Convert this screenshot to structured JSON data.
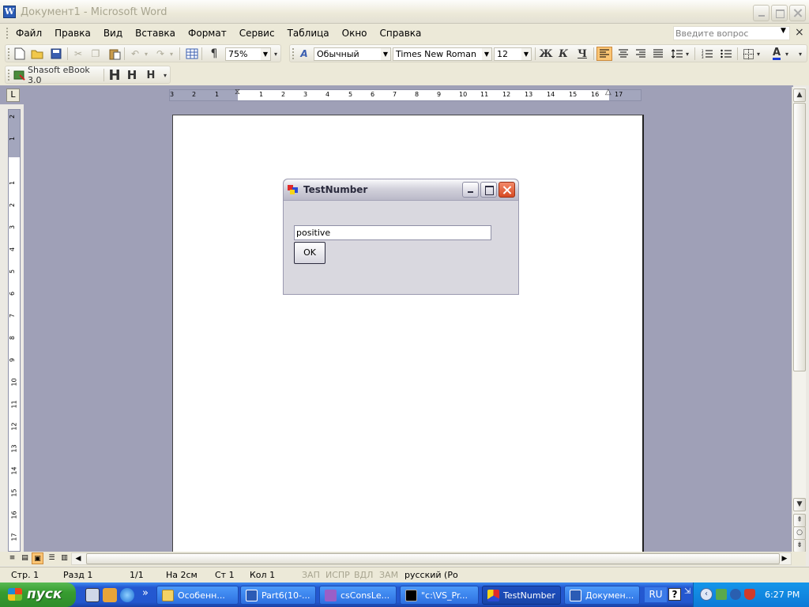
{
  "window": {
    "title": "Документ1 - Microsoft Word",
    "icon": "word-doc-icon"
  },
  "menubar": {
    "items": [
      "Файл",
      "Правка",
      "Вид",
      "Вставка",
      "Формат",
      "Сервис",
      "Таблица",
      "Окно",
      "Справка"
    ],
    "ask_placeholder": "Введите вопрос"
  },
  "standard_toolbar": {
    "zoom": "75%",
    "paragraph_mark": "¶"
  },
  "format_toolbar": {
    "style": "Обычный",
    "font": "Times New Roman",
    "size": "12",
    "bold": "Ж",
    "italic": "К",
    "underline": "Ч"
  },
  "ebook_toolbar": {
    "label": "Shasoft eBook 3.0",
    "h1": "H",
    "h2": "H",
    "h3": "H"
  },
  "ruler": {
    "tab_selector": "L",
    "h_ticks": [
      "3",
      "2",
      "1",
      "1",
      "2",
      "3",
      "4",
      "5",
      "6",
      "7",
      "8",
      "9",
      "10",
      "11",
      "12",
      "13",
      "14",
      "15",
      "16",
      "17"
    ],
    "v_ticks": [
      "2",
      "1",
      "1",
      "2",
      "3",
      "4",
      "5",
      "6",
      "7",
      "8",
      "9",
      "10",
      "11",
      "12",
      "13",
      "14",
      "15",
      "16",
      "17"
    ]
  },
  "dialog": {
    "title": "TestNumber",
    "input_value": "positive",
    "ok_label": "OK"
  },
  "statusbar": {
    "page": "Стр. 1",
    "section": "Разд 1",
    "pages": "1/1",
    "at": "На 2см",
    "line": "Ст 1",
    "col": "Кол 1",
    "rec": "ЗАП",
    "trk": "ИСПР",
    "ext": "ВДЛ",
    "ovr": "ЗАМ",
    "language": "русский (Ро"
  },
  "taskbar": {
    "start_label": "пуск",
    "tasks": [
      {
        "label": "Особенн...",
        "icon": "folder-icon"
      },
      {
        "label": "Part6(10-...",
        "icon": "word-doc-icon"
      },
      {
        "label": "csConsLe...",
        "icon": "visual-studio-icon"
      },
      {
        "label": "\"c:\\VS_Pr...",
        "icon": "console-icon"
      },
      {
        "label": "TestNumber",
        "icon": "form-app-icon"
      },
      {
        "label": "Докумен...",
        "icon": "word-doc-icon"
      }
    ],
    "lang": "RU",
    "help": "?",
    "clock": "6:27 PM"
  }
}
